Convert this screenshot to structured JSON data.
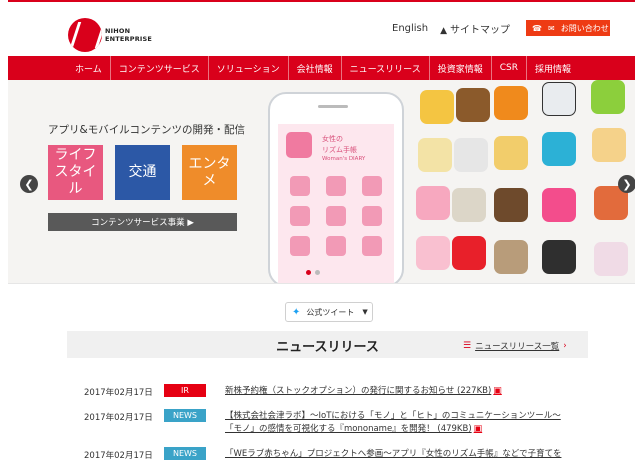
{
  "header": {
    "logo_text_line1": "NIHON",
    "logo_text_line2": "ENTERPRISE",
    "english_label": "English",
    "sitemap_label": "サイトマップ",
    "contact_label": "お問い合わせ"
  },
  "nav": {
    "items": [
      "ホーム",
      "コンテンツサービス",
      "ソリューション",
      "会社情報",
      "ニュースリリース",
      "投資家情報",
      "CSR",
      "採用情報"
    ]
  },
  "hero": {
    "title": "アプリ&モバイルコンテンツの開発・配信",
    "tiles": [
      "ライフ\nスタイル",
      "交通",
      "エンタメ"
    ],
    "service_button": "コンテンツサービス事業 ▶",
    "app_title_line1": "女性の",
    "app_title_line2": "リズム手帳",
    "app_title_line3": "Woman's DIARY",
    "slide_count": 2,
    "active_slide": 1
  },
  "tweet": {
    "label": "公式ツイート"
  },
  "news": {
    "heading": "ニュースリリース",
    "list_link": "ニュースリリース一覧",
    "items": [
      {
        "date": "2017年02月17日",
        "badge": "IR",
        "text_line1": "新株予約権（ストックオプション）の発行に関するお知らせ (227KB)",
        "text_line2": ""
      },
      {
        "date": "2017年02月17日",
        "badge": "NEWS",
        "text_line1": "【株式会社会津ラボ】～IoTにおける「モノ」と「ヒト」のコミュニケーションツール～",
        "text_line2": "「モノ」の感情を可視化する『mononame』を開発！ (479KB)"
      },
      {
        "date": "2017年02月17日",
        "badge": "NEWS",
        "text_line1": "「WEラブ赤ちゃん」プロジェクトへ参画～アプリ『女性のリズム手帳』などで子育てを",
        "text_line2": ""
      }
    ]
  },
  "colors": {
    "brand_red": "#d9001b",
    "contact_orange": "#ee3b14",
    "tile_pink": "#e8587f",
    "tile_blue": "#2c58a6",
    "tile_orange": "#ef8c2a",
    "badge_ir": "#e60012",
    "badge_news": "#3aa3c8"
  },
  "icons": [
    "logo-icon",
    "sitemap-icon",
    "phone-icon",
    "mail-icon",
    "arrow-left-icon",
    "arrow-right-icon",
    "twitter-bird-icon",
    "chevron-down-icon",
    "list-icon",
    "pdf-icon"
  ]
}
